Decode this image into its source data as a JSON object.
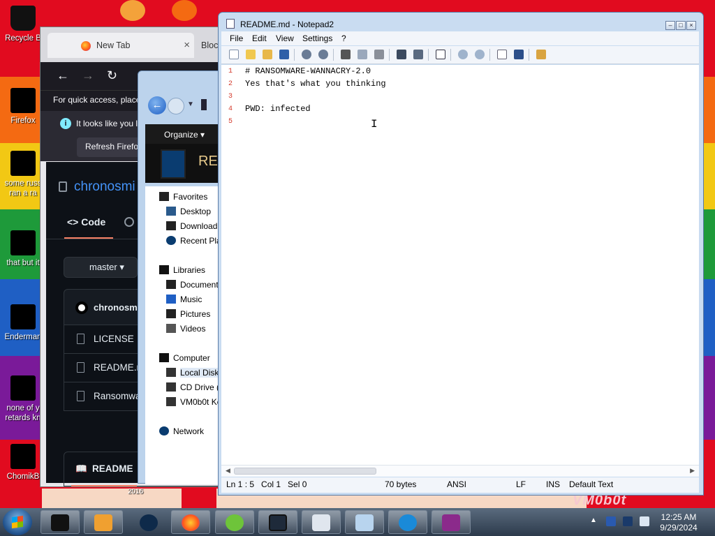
{
  "desktop": {
    "icons": [
      {
        "line1": "Recycle B",
        "line2": ""
      },
      {
        "line1": "Firefox",
        "line2": ""
      },
      {
        "line1": "some russ",
        "line2": "ran a ra"
      },
      {
        "line1": "that but it",
        "line2": ""
      },
      {
        "line1": "Enderman",
        "line2": ""
      },
      {
        "line1": "none of y",
        "line2": "retards kn"
      },
      {
        "line1": "ChomikB",
        "line2": ""
      }
    ],
    "wallpaper_text": "VM0b0t",
    "wallpaper_year": "2016"
  },
  "firefox": {
    "tab_title": "New Tab",
    "tab_close": "×",
    "tab2_title": "Bloc",
    "back": "←",
    "forward": "→",
    "reload": "↻",
    "bookmarks_text": "For quick access, place",
    "notice_text": "It looks like you l",
    "notice_icon": "i",
    "notice_button": "Refresh Firefox",
    "github": {
      "repo": "chronosmi",
      "code_tab": "Code",
      "branch": "master",
      "commit_user": "chronosmi",
      "files": [
        "LICENSE",
        "README.m",
        "Ransomwa"
      ],
      "readme_tab": "README"
    }
  },
  "explorer": {
    "organize": "Organize ▾",
    "header_title": "REA",
    "back_glyph": "←",
    "nav": [
      {
        "label": "Favorites"
      },
      {
        "label": "Desktop"
      },
      {
        "label": "Download"
      },
      {
        "label": "Recent Pla"
      },
      {
        "label": "Libraries"
      },
      {
        "label": "Document"
      },
      {
        "label": "Music"
      },
      {
        "label": "Pictures"
      },
      {
        "label": "Videos"
      },
      {
        "label": "Computer"
      },
      {
        "label": "Local Disk"
      },
      {
        "label": "CD Drive ("
      },
      {
        "label": "VM0b0t Ke"
      },
      {
        "label": "Network"
      }
    ]
  },
  "notepad": {
    "title": "README.md - Notepad2",
    "controls": {
      "minimize": "–",
      "maximize": "□",
      "close": "×"
    },
    "menu": [
      "File",
      "Edit",
      "View",
      "Settings",
      "?"
    ],
    "toolbar_icons": [
      "new-icon",
      "open-icon",
      "browse-icon",
      "save-icon",
      "undo-icon",
      "redo-icon",
      "cut-icon",
      "copy-icon",
      "paste-icon",
      "find-icon",
      "replace-icon",
      "wordwrap-icon",
      "zoom-in-icon",
      "zoom-out-icon",
      "select-scheme-icon",
      "customize-icon",
      "exit-icon"
    ],
    "lines": [
      {
        "num": "1",
        "text": "# RANSOMWARE-WANNACRY-2.0"
      },
      {
        "num": "2",
        "text": "Yes that's what you thinking"
      },
      {
        "num": "3",
        "text": ""
      },
      {
        "num": "4",
        "text": "PWD: infected"
      },
      {
        "num": "5",
        "text": ""
      }
    ],
    "status": {
      "position": "Ln 1 : 5   Col 1   Sel 0",
      "size": "70 bytes",
      "encoding": "ANSI",
      "eol": "LF",
      "mode": "INS",
      "scheme": "Default Text"
    },
    "cursor_glyph": "I"
  },
  "taskbar": {
    "clock_time": "12:25 AM",
    "clock_date": "9/29/2024",
    "tray_arrow": "▲",
    "apps": [
      "explorer-window-icon",
      "media-player-icon",
      "globe-icon",
      "firefox-icon",
      "cleaner-icon",
      "screen-icon",
      "java-icon",
      "notepad-icon",
      "internet-explorer-icon",
      "winrar-icon"
    ]
  },
  "colors": {
    "accent_blue": "#4493f8",
    "github_bg": "#0d1117",
    "line_number": "#d43a2c"
  }
}
